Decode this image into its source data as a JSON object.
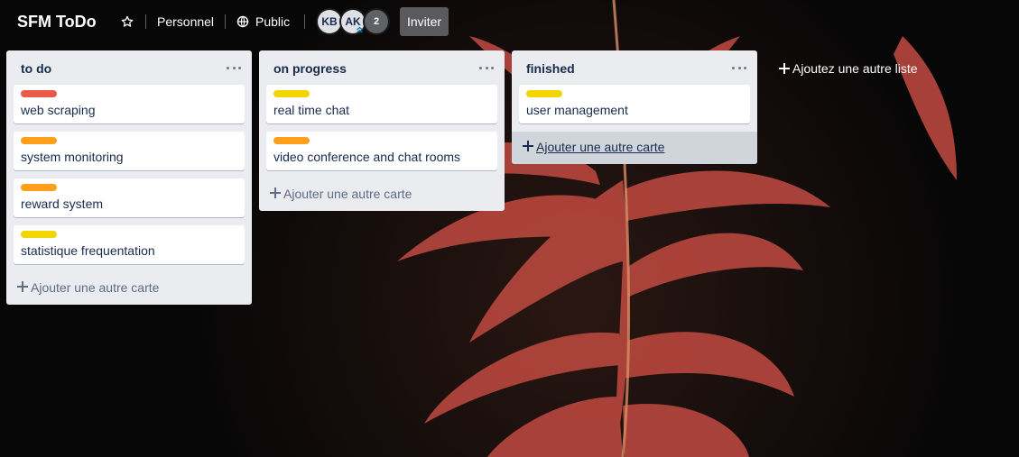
{
  "header": {
    "board_title": "SFM ToDo",
    "personal_label": "Personnel",
    "visibility_label": "Public",
    "members": [
      {
        "initials": "KB"
      },
      {
        "initials": "AK"
      }
    ],
    "more_members": "2",
    "invite_label": "Inviter"
  },
  "colors": {
    "red": "#eb5a46",
    "orange": "#ff9f1a",
    "yellow": "#f2d600",
    "list_bg": "#ebecf0",
    "text": "#172b4d"
  },
  "lists": [
    {
      "title": "to do",
      "add_card": "Ajouter une autre carte",
      "cards": [
        {
          "label_color": "#eb5a46",
          "title": "web scraping"
        },
        {
          "label_color": "#ff9f1a",
          "title": "system monitoring"
        },
        {
          "label_color": "#ff9f1a",
          "title": "reward system"
        },
        {
          "label_color": "#f2d600",
          "title": "statistique frequentation"
        }
      ]
    },
    {
      "title": "on progress",
      "add_card": "Ajouter une autre carte",
      "cards": [
        {
          "label_color": "#f2d600",
          "title": "real time chat"
        },
        {
          "label_color": "#ff9f1a",
          "title": "video conference and chat rooms"
        }
      ]
    },
    {
      "title": "finished",
      "add_card": "Ajouter une autre carte",
      "cards": [
        {
          "label_color": "#f2d600",
          "title": "user management"
        }
      ]
    }
  ],
  "add_list_label": "Ajoutez une autre liste"
}
